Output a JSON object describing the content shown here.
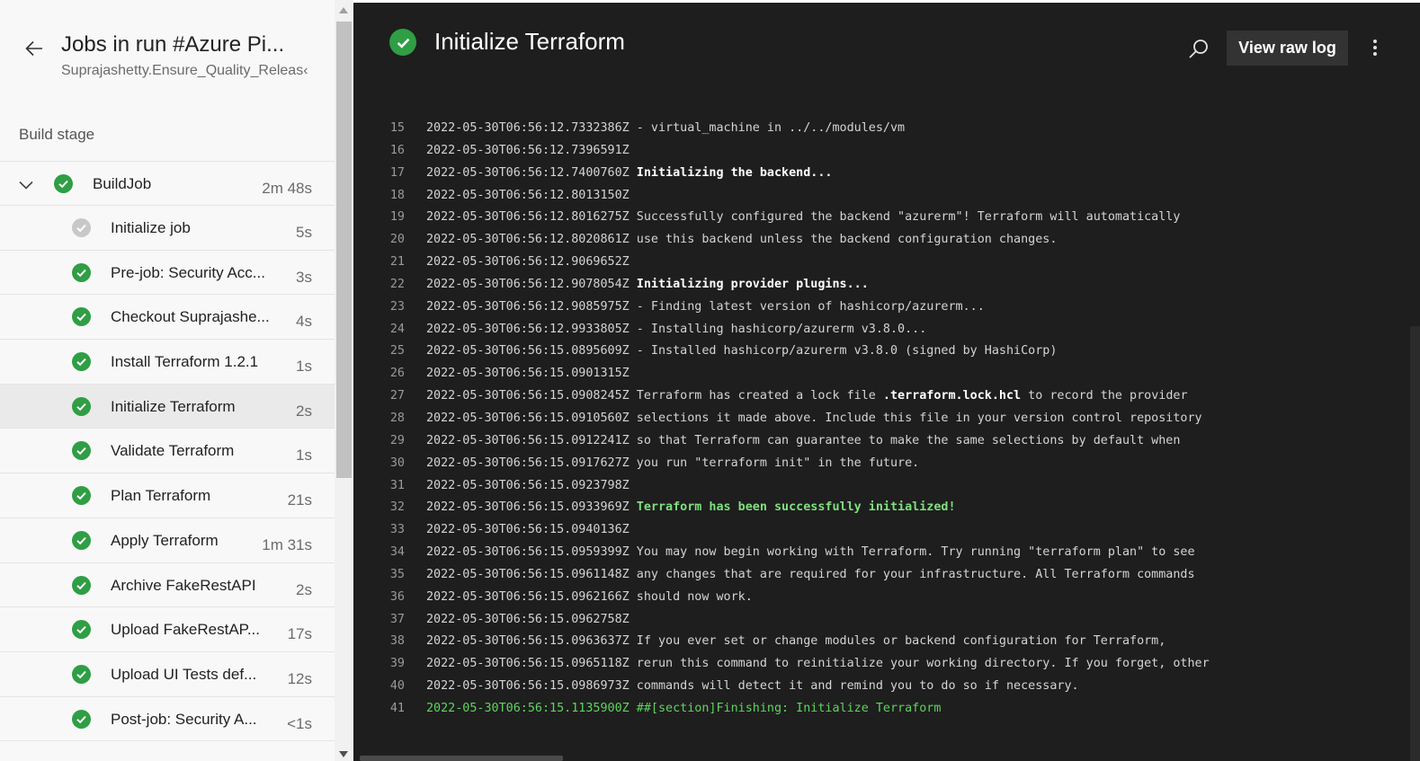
{
  "header": {
    "title": "Jobs in run #Azure Pi...",
    "subtitle": "Suprajashetty.Ensure_Quality_Releas‹"
  },
  "stage": {
    "label": "Build stage"
  },
  "job": {
    "name": "BuildJob",
    "duration": "2m 48s"
  },
  "steps": [
    {
      "name": "Initialize job",
      "duration": "5s",
      "status": "pending"
    },
    {
      "name": "Pre-job: Security Acc...",
      "duration": "3s",
      "status": "ok"
    },
    {
      "name": "Checkout Suprajashe...",
      "duration": "4s",
      "status": "ok"
    },
    {
      "name": "Install Terraform 1.2.1",
      "duration": "1s",
      "status": "ok"
    },
    {
      "name": "Initialize Terraform",
      "duration": "2s",
      "status": "ok"
    },
    {
      "name": "Validate Terraform",
      "duration": "1s",
      "status": "ok"
    },
    {
      "name": "Plan Terraform",
      "duration": "21s",
      "status": "ok"
    },
    {
      "name": "Apply Terraform",
      "duration": "1m 31s",
      "status": "ok"
    },
    {
      "name": "Archive FakeRestAPI",
      "duration": "2s",
      "status": "ok"
    },
    {
      "name": "Upload FakeRestAP...",
      "duration": "17s",
      "status": "ok"
    },
    {
      "name": "Upload UI Tests def...",
      "duration": "12s",
      "status": "ok"
    },
    {
      "name": "Post-job: Security A...",
      "duration": "<1s",
      "status": "ok"
    }
  ],
  "log": {
    "title": "Initialize Terraform",
    "view_raw_label": "View raw log",
    "lines": [
      {
        "n": "15",
        "ts": "2022-05-30T06:56:12.7332386Z",
        "msg": " - virtual_machine in ../../modules/vm"
      },
      {
        "n": "16",
        "ts": "2022-05-30T06:56:12.7396591Z",
        "msg": ""
      },
      {
        "n": "17",
        "ts": "2022-05-30T06:56:12.7400760Z",
        "msg": " Initializing the backend...",
        "style": "bold"
      },
      {
        "n": "18",
        "ts": "2022-05-30T06:56:12.8013150Z",
        "msg": ""
      },
      {
        "n": "19",
        "ts": "2022-05-30T06:56:12.8016275Z",
        "msg": " Successfully configured the backend \"azurerm\"! Terraform will automatically"
      },
      {
        "n": "20",
        "ts": "2022-05-30T06:56:12.8020861Z",
        "msg": " use this backend unless the backend configuration changes."
      },
      {
        "n": "21",
        "ts": "2022-05-30T06:56:12.9069652Z",
        "msg": ""
      },
      {
        "n": "22",
        "ts": "2022-05-30T06:56:12.9078054Z",
        "msg": " Initializing provider plugins...",
        "style": "bold"
      },
      {
        "n": "23",
        "ts": "2022-05-30T06:56:12.9085975Z",
        "msg": " - Finding latest version of hashicorp/azurerm..."
      },
      {
        "n": "24",
        "ts": "2022-05-30T06:56:12.9933805Z",
        "msg": " - Installing hashicorp/azurerm v3.8.0..."
      },
      {
        "n": "25",
        "ts": "2022-05-30T06:56:15.0895609Z",
        "msg": " - Installed hashicorp/azurerm v3.8.0 (signed by HashiCorp)"
      },
      {
        "n": "26",
        "ts": "2022-05-30T06:56:15.0901315Z",
        "msg": ""
      },
      {
        "n": "27",
        "ts": "2022-05-30T06:56:15.0908245Z",
        "msg": " Terraform has created a lock file ",
        "hl": ".terraform.lock.hcl",
        "msg2": " to record the provider"
      },
      {
        "n": "28",
        "ts": "2022-05-30T06:56:15.0910560Z",
        "msg": " selections it made above. Include this file in your version control repository"
      },
      {
        "n": "29",
        "ts": "2022-05-30T06:56:15.0912241Z",
        "msg": " so that Terraform can guarantee to make the same selections by default when"
      },
      {
        "n": "30",
        "ts": "2022-05-30T06:56:15.0917627Z",
        "msg": " you run \"terraform init\" in the future."
      },
      {
        "n": "31",
        "ts": "2022-05-30T06:56:15.0923798Z",
        "msg": ""
      },
      {
        "n": "32",
        "ts": "2022-05-30T06:56:15.0933969Z",
        "msg": " Terraform has been successfully initialized!",
        "style": "green"
      },
      {
        "n": "33",
        "ts": "2022-05-30T06:56:15.0940136Z",
        "msg": ""
      },
      {
        "n": "34",
        "ts": "2022-05-30T06:56:15.0959399Z",
        "msg": " You may now begin working with Terraform. Try running \"terraform plan\" to see"
      },
      {
        "n": "35",
        "ts": "2022-05-30T06:56:15.0961148Z",
        "msg": " any changes that are required for your infrastructure. All Terraform commands"
      },
      {
        "n": "36",
        "ts": "2022-05-30T06:56:15.0962166Z",
        "msg": " should now work."
      },
      {
        "n": "37",
        "ts": "2022-05-30T06:56:15.0962758Z",
        "msg": ""
      },
      {
        "n": "38",
        "ts": "2022-05-30T06:56:15.0963637Z",
        "msg": " If you ever set or change modules or backend configuration for Terraform,"
      },
      {
        "n": "39",
        "ts": "2022-05-30T06:56:15.0965118Z",
        "msg": " rerun this command to reinitialize your working directory. If you forget, other"
      },
      {
        "n": "40",
        "ts": "2022-05-30T06:56:15.0986973Z",
        "msg": " commands will detect it and remind you to do so if necessary."
      },
      {
        "n": "41",
        "ts": "2022-05-30T06:56:15.1135900Z",
        "msg": " ##[section]Finishing: Initialize Terraform",
        "style": "section"
      }
    ]
  }
}
